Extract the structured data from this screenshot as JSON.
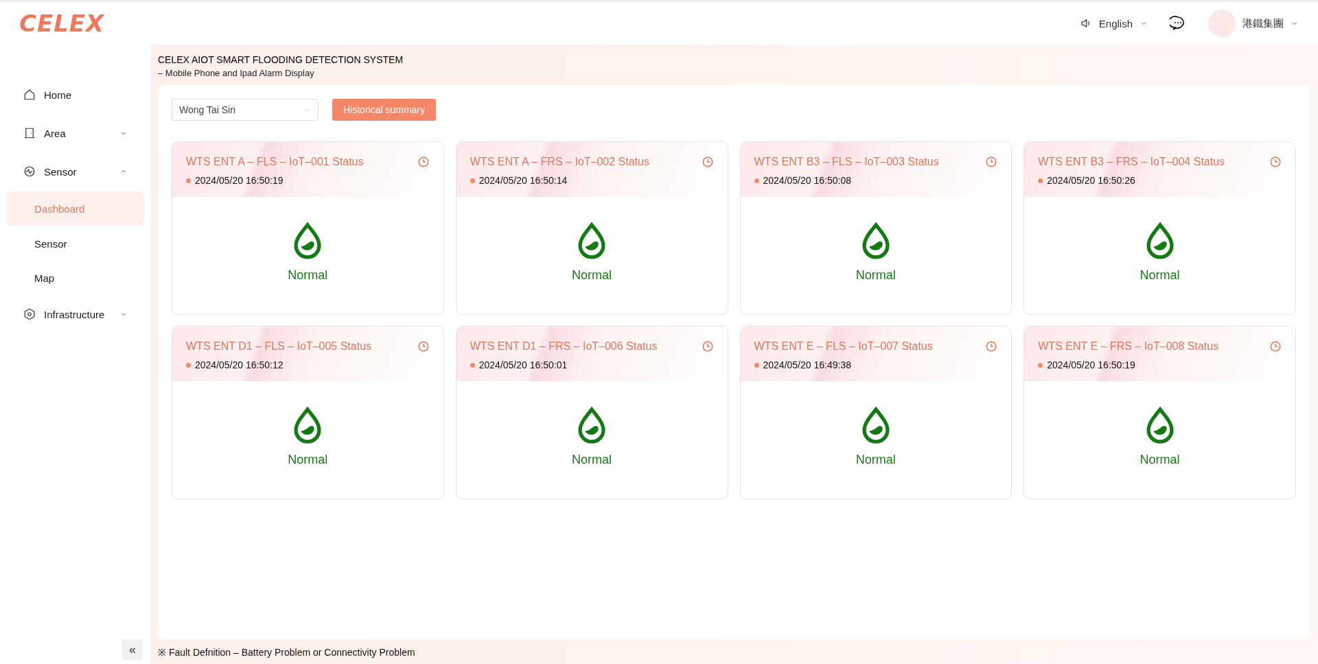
{
  "logo": {
    "text": "CELEX"
  },
  "header": {
    "language": "English",
    "user": "港鐵集團"
  },
  "sidebar": {
    "items": [
      {
        "label": "Home"
      },
      {
        "label": "Area",
        "expanded": false
      },
      {
        "label": "Sensor",
        "expanded": true,
        "children": [
          {
            "label": "Dashboard",
            "selected": true
          },
          {
            "label": "Sensor",
            "selected": false
          },
          {
            "label": "Map",
            "selected": false
          }
        ]
      },
      {
        "label": "Infrastructure",
        "expanded": false
      }
    ]
  },
  "page": {
    "title": "CELEX AIOT SMART FLOODING DETECTION SYSTEM",
    "subtitle": "– Mobile Phone and Ipad Alarm Display"
  },
  "filter": {
    "value": "Wong Tai Sin"
  },
  "summary_button": "Historical summary",
  "cards": [
    {
      "title": "WTS ENT A – FLS – IoT–001 Status",
      "time": "2024/05/20 16:50:19",
      "status": "Normal",
      "kind": "normal"
    },
    {
      "title": "WTS ENT A – FRS – IoT–002 Status",
      "time": "2024/05/20 16:50:14",
      "status": "Normal",
      "kind": "normal"
    },
    {
      "title": "WTS ENT B3 – FLS – IoT–003 Status",
      "time": "2024/05/20 16:50:08",
      "status": "Normal",
      "kind": "normal"
    },
    {
      "title": "WTS ENT B3 – FRS – IoT–004 Status",
      "time": "2024/05/20 16:50:26",
      "status": "Normal",
      "kind": "normal"
    },
    {
      "title": "WTS ENT D1 – FLS – IoT–005 Status",
      "time": "2024/05/20 16:50:12",
      "status": "Normal",
      "kind": "normal"
    },
    {
      "title": "WTS ENT D1 – FRS – IoT–006 Status",
      "time": "2024/05/20 16:50:01",
      "status": "Normal",
      "kind": "normal"
    },
    {
      "title": "WTS ENT E – FLS – IoT–007 Status",
      "time": "2024/05/20 16:49:38",
      "status": "Normal",
      "kind": "normal"
    },
    {
      "title": "WTS ENT E – FRS – IoT–008 Status",
      "time": "2024/05/20 16:50:19",
      "status": "Normal",
      "kind": "normal"
    }
  ],
  "footer": {
    "note": "※ Fault Defnition – Battery Problem or Connectivity Problem"
  },
  "collapse_button": "«"
}
